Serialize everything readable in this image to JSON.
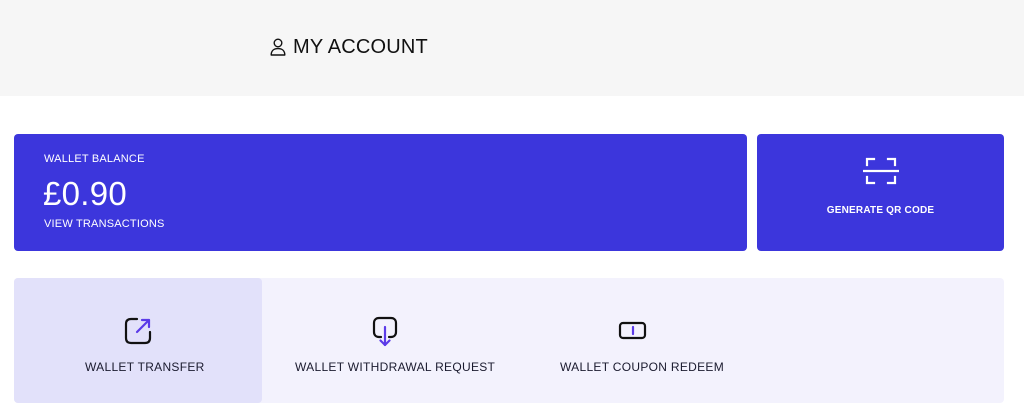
{
  "header": {
    "title": "MY ACCOUNT",
    "icon": "user-icon"
  },
  "wallet": {
    "balance_label": "WALLET BALANCE",
    "balance_amount": "£0.90",
    "view_transactions_label": "VIEW TRANSACTIONS"
  },
  "qr": {
    "label": "GENERATE QR CODE",
    "icon": "qr-scan-icon"
  },
  "actions": [
    {
      "label": "WALLET TRANSFER",
      "icon": "external-transfer-icon",
      "selected": true
    },
    {
      "label": "WALLET WITHDRAWAL REQUEST",
      "icon": "withdraw-icon",
      "selected": false
    },
    {
      "label": "WALLET COUPON REDEEM",
      "icon": "coupon-icon",
      "selected": false
    }
  ],
  "colors": {
    "accent": "#3c36dc",
    "accent_light": "#e2e1fa",
    "panel_bg": "#f3f2fd",
    "header_bg": "#f6f6f6",
    "icon_accent": "#5b3be8"
  }
}
